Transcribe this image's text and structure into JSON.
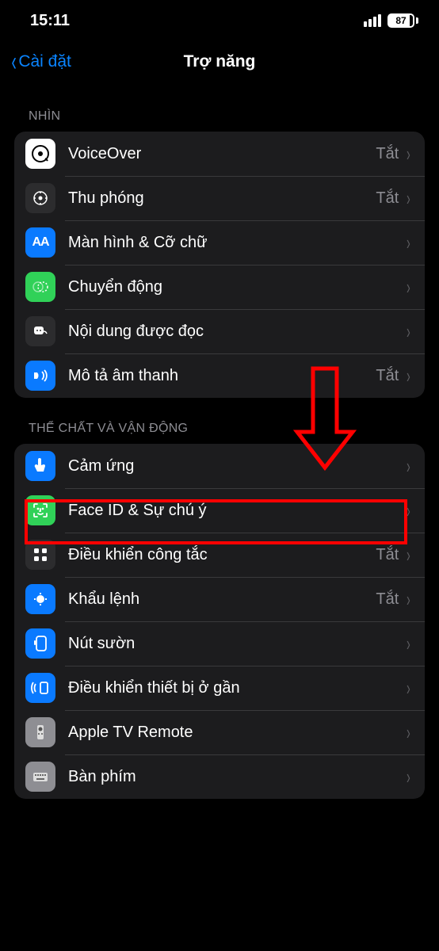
{
  "status": {
    "time": "15:11",
    "battery_pct": "87"
  },
  "nav": {
    "back_label": "Cài đặt",
    "title": "Trợ năng"
  },
  "sections": {
    "vision": {
      "header": "NHÌN",
      "rows": {
        "voiceover": {
          "label": "VoiceOver",
          "value": "Tắt"
        },
        "zoom": {
          "label": "Thu phóng",
          "value": "Tắt"
        },
        "display": {
          "label": "Màn hình & Cỡ chữ",
          "value": ""
        },
        "motion": {
          "label": "Chuyển động",
          "value": ""
        },
        "spoken": {
          "label": "Nội dung được đọc",
          "value": ""
        },
        "audiodesc": {
          "label": "Mô tả âm thanh",
          "value": "Tắt"
        }
      }
    },
    "motor": {
      "header": "THỂ CHẤT VÀ VẬN ĐỘNG",
      "rows": {
        "touch": {
          "label": "Cảm ứng",
          "value": ""
        },
        "faceid": {
          "label": "Face ID & Sự chú ý",
          "value": ""
        },
        "switch": {
          "label": "Điều khiển công tắc",
          "value": "Tắt"
        },
        "voicectrl": {
          "label": "Khẩu lệnh",
          "value": "Tắt"
        },
        "sidebtn": {
          "label": "Nút sườn",
          "value": ""
        },
        "nearby": {
          "label": "Điều khiển thiết bị ở gần",
          "value": ""
        },
        "appletv": {
          "label": "Apple TV Remote",
          "value": ""
        },
        "keyboard": {
          "label": "Bàn phím",
          "value": ""
        }
      }
    }
  },
  "annotation": {
    "highlight_row": "touch",
    "highlight_color": "#ff0000"
  }
}
